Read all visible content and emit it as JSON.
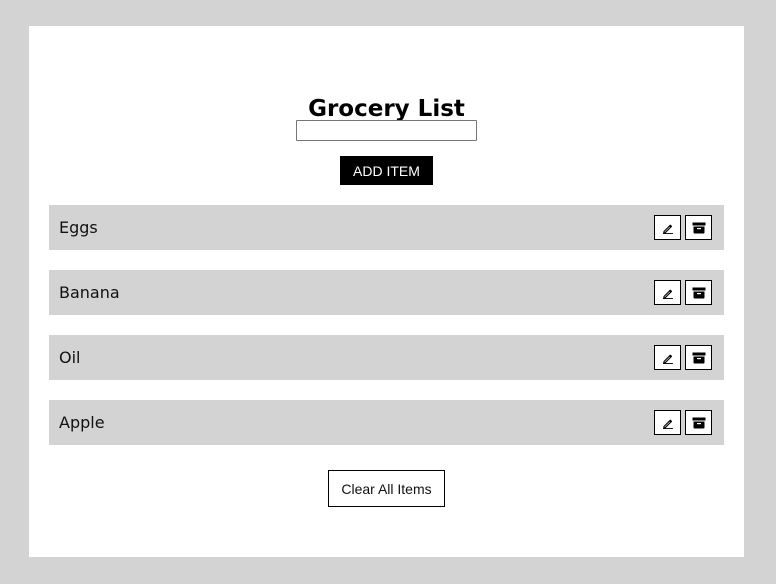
{
  "app": {
    "title": "Grocery List"
  },
  "form": {
    "input_value": "",
    "input_placeholder": "",
    "add_label": "ADD ITEM"
  },
  "items": [
    {
      "name": "Eggs",
      "edit_icon": "pencil-icon",
      "archive_icon": "archive-icon"
    },
    {
      "name": "Banana",
      "edit_icon": "pencil-icon",
      "archive_icon": "archive-icon"
    },
    {
      "name": "Oil",
      "edit_icon": "pencil-icon",
      "archive_icon": "archive-icon"
    },
    {
      "name": "Apple",
      "edit_icon": "pencil-icon",
      "archive_icon": "archive-icon"
    }
  ],
  "footer": {
    "clear_label": "Clear All Items"
  },
  "colors": {
    "page_background": "#d3d3d3",
    "card_background": "#ffffff",
    "item_background": "#d3d3d3",
    "primary_button": "#000000"
  }
}
